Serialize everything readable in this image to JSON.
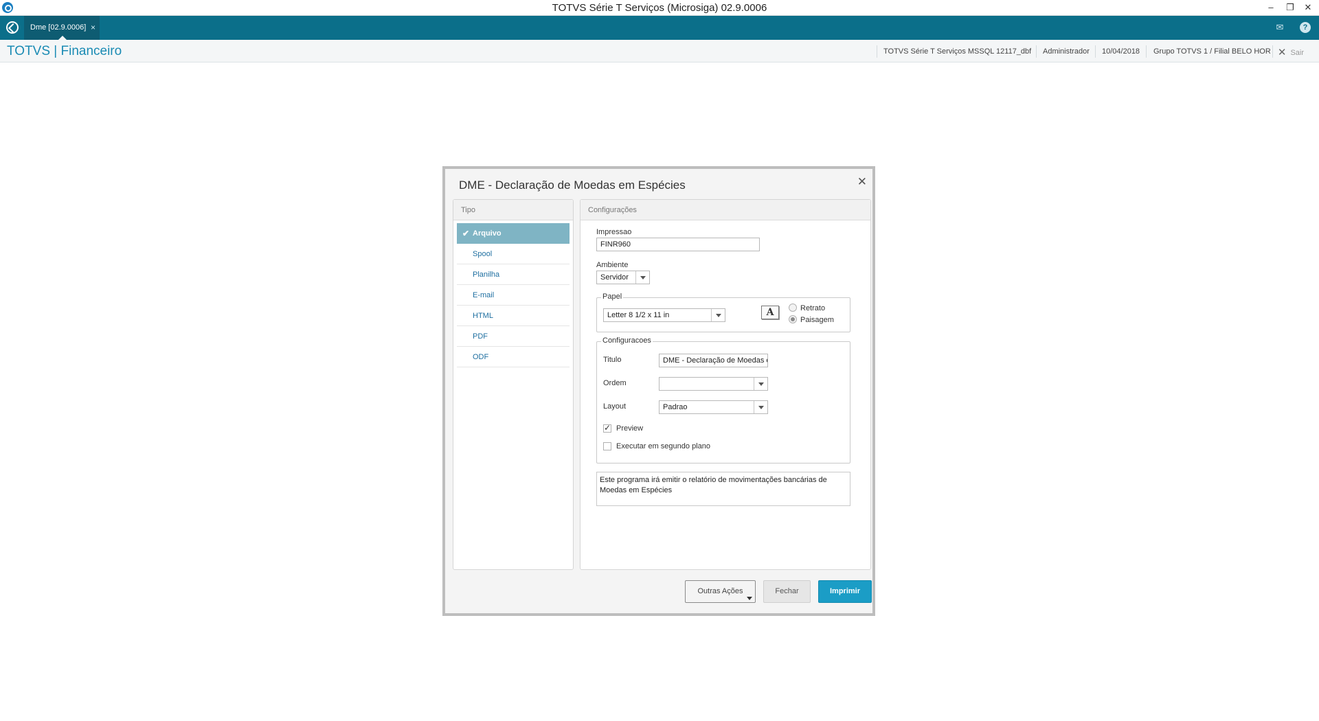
{
  "window": {
    "title": "TOTVS Série T Serviços (Microsiga) 02.9.0006"
  },
  "tabbar": {
    "tab_label": "Dme [02.9.0006]",
    "tab_close": "×"
  },
  "header": {
    "brand": "TOTVS | Financeiro",
    "environment": "TOTVS Série T Serviços MSSQL 12117_dbf",
    "user": "Administrador",
    "date": "10/04/2018",
    "branch": "Grupo TOTVS 1 / Filial BELO HOR",
    "exit_label": "Sair"
  },
  "dialog": {
    "title": "DME - Declaração de Moedas em Espécies",
    "tipo": {
      "heading": "Tipo",
      "items": [
        {
          "label": "Arquivo",
          "selected": true
        },
        {
          "label": "Spool"
        },
        {
          "label": "Planilha"
        },
        {
          "label": "E-mail"
        },
        {
          "label": "HTML"
        },
        {
          "label": "PDF"
        },
        {
          "label": "ODF"
        }
      ]
    },
    "config": {
      "heading": "Configurações",
      "impressao_label": "Impressao",
      "impressao_value": "FINR960",
      "ambiente_label": "Ambiente",
      "ambiente_value": "Servidor",
      "papel": {
        "legend": "Papel",
        "paper_value": "Letter 8 1/2 x 11 in",
        "font_icon_glyph": "A",
        "retrato_label": "Retrato",
        "paisagem_label": "Paisagem",
        "orientation_selected": "Paisagem"
      },
      "configuracoes": {
        "legend": "Configuracoes",
        "titulo_label": "Titulo",
        "titulo_value": "DME - Declaração de Moedas e",
        "ordem_label": "Ordem",
        "ordem_value": "",
        "layout_label": "Layout",
        "layout_value": "Padrao",
        "preview_label": "Preview",
        "preview_checked": true,
        "background_label": "Executar em segundo plano",
        "background_checked": false
      },
      "description": "Este programa irá emitir o relatório de movimentações bancárias de Moedas em Espécies"
    },
    "buttons": {
      "outras": "Outras Ações",
      "fechar": "Fechar",
      "imprimir": "Imprimir"
    }
  }
}
